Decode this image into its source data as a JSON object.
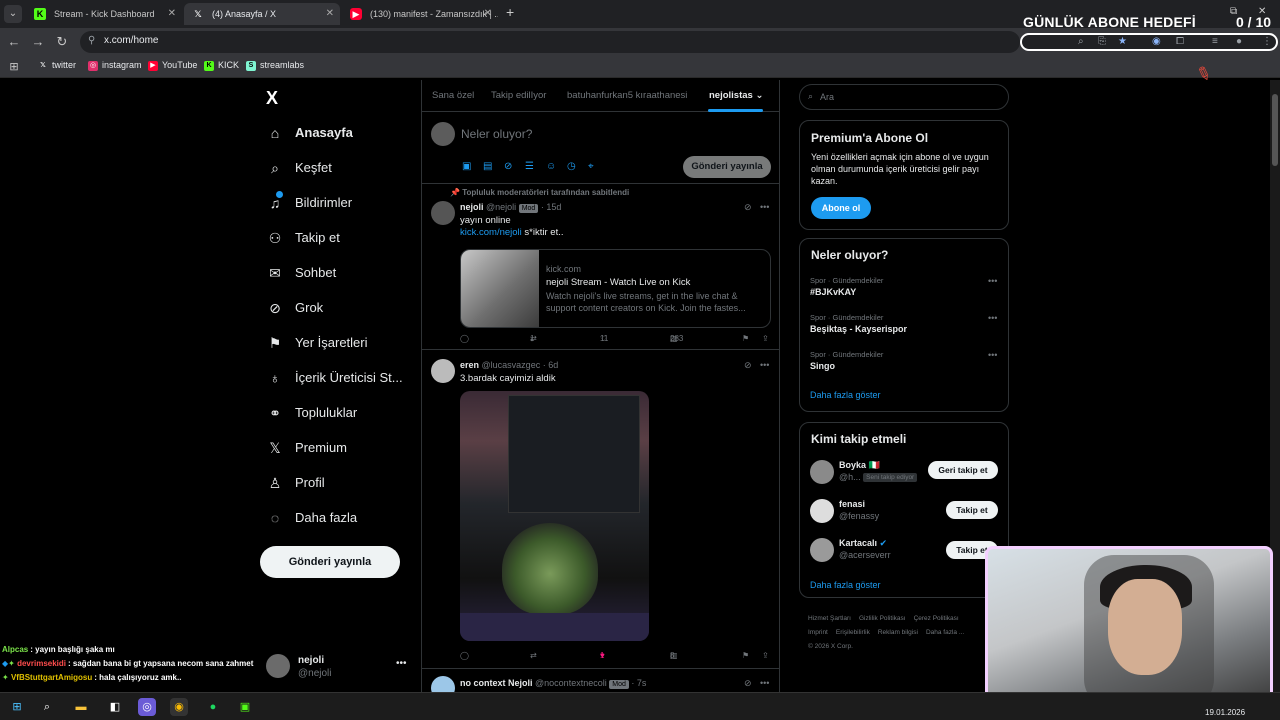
{
  "browser": {
    "tabs": [
      {
        "title": "Stream - Kick Dashboard",
        "icon": "kick-icon",
        "color": "#53fc18"
      },
      {
        "title": "(4) Anasayfa / X",
        "icon": "x-icon",
        "color": "#ffffff"
      },
      {
        "title": "(130) manifest - Zamansızdık | ...",
        "icon": "youtube-icon",
        "color": "#ff0033"
      }
    ],
    "url": "x.com/home",
    "bookmarks": [
      {
        "label": "twitter",
        "icon": "x-icon"
      },
      {
        "label": "instagram",
        "icon": "instagram-icon"
      },
      {
        "label": "YouTube",
        "icon": "youtube-icon"
      },
      {
        "label": "KICK",
        "icon": "kick-icon"
      },
      {
        "label": "streamlabs",
        "icon": "streamlabs-icon"
      }
    ]
  },
  "overlay": {
    "goal_title": "GÜNLÜK ABONE HEDEFİ",
    "goal_count": "0  / 10",
    "chat": [
      {
        "user": "Alpcas",
        "user_color": "#7be34a",
        "msg": ": yayın başlığı şaka mı"
      },
      {
        "user": "devrimsekidi",
        "user_color": "#ff4d4d",
        "msg": ": sağdan bana bi gt yapsana necom sana zahmet"
      },
      {
        "user": "VfBStuttgartAmigosu",
        "user_color": "#e0c000",
        "msg": ": hala çalışıyoruz amk.."
      }
    ],
    "date": "19.01.2026"
  },
  "nav": {
    "logo": "X",
    "items": [
      {
        "label": "Anasayfa",
        "icon": "home-icon",
        "bold": true
      },
      {
        "label": "Keşfet",
        "icon": "search-icon"
      },
      {
        "label": "Bildirimler",
        "icon": "bell-icon"
      },
      {
        "label": "Takip et",
        "icon": "add-person-icon"
      },
      {
        "label": "Sohbet",
        "icon": "mail-icon"
      },
      {
        "label": "Grok",
        "icon": "grok-icon"
      },
      {
        "label": "Yer İşaretleri",
        "icon": "bookmark-icon"
      },
      {
        "label": "İçerik Üreticisi St...",
        "icon": "creator-icon"
      },
      {
        "label": "Topluluklar",
        "icon": "communities-icon"
      },
      {
        "label": "Premium",
        "icon": "x-icon"
      },
      {
        "label": "Profil",
        "icon": "person-icon"
      },
      {
        "label": "Daha fazla",
        "icon": "more-circle-icon"
      }
    ],
    "post_button": "Gönderi yayınla",
    "account": {
      "name": "nejoli",
      "handle": "@nejoli"
    }
  },
  "timeline": {
    "tabs": [
      "Sana özel",
      "Takip edilIyor",
      "batuhanfurkan5 kıraathanesi",
      "nejolistas"
    ],
    "compose_placeholder": "Neler oluyor?",
    "compose_button": "Gönderi yayınla",
    "tweets": [
      {
        "pinned": "Topluluk moderatörleri tarafından sabitlendi",
        "name": "nejoli",
        "handle": "@nejoli",
        "badge": "Mod",
        "time": "· 15d",
        "text1": "yayın online",
        "link": "kick.com/nejoli",
        "text2": " s*iktir et..",
        "card": {
          "domain": "kick.com",
          "title": "nejoli Stream - Watch Live on Kick",
          "desc": "Watch nejoli's live streams, get in the live chat & support content creators on Kick. Join the fastes..."
        },
        "reply": "",
        "retweet": "1",
        "like": "11",
        "views": "283"
      },
      {
        "name": "eren",
        "handle": "@lucasvazgec",
        "time": "· 6d",
        "text1": "3.bardak cayimizi aldik",
        "reply": "",
        "retweet": "",
        "like": "1",
        "views": "8"
      },
      {
        "name": "no context Nejoli",
        "handle": "@nocontextnecoli",
        "badge": "Mod",
        "time": "· 7s"
      }
    ]
  },
  "sidebar": {
    "search_placeholder": "Ara",
    "premium": {
      "title": "Premium'a Abone Ol",
      "desc": "Yeni özellikleri açmak için abone ol ve uygun olman durumunda içerik üreticisi gelir payı kazan.",
      "button": "Abone ol"
    },
    "trends_title": "Neler oluyor?",
    "trends": [
      {
        "cat": "Spor · Gündemdekiler",
        "name": "#BJKvKAY"
      },
      {
        "cat": "Spor · Gündemdekiler",
        "name": "Beşiktaş - Kayserispor"
      },
      {
        "cat": "Spor · Gündemdekiler",
        "name": "Singo"
      }
    ],
    "show_more": "Daha fazla göster",
    "wtf_title": "Kimi takip etmeli",
    "wtf": [
      {
        "name": "Boyka 🇮🇹",
        "handle": "@h...",
        "tag": "Seni takip ediyor",
        "button": "Geri takip et"
      },
      {
        "name": "fenasi",
        "handle": "@fenassy",
        "button": "Takip et"
      },
      {
        "name": "Kartacalı",
        "handle": "@acerseverr",
        "button": "Takip et",
        "verified": true
      }
    ],
    "wtf_more": "Daha fazla göster",
    "footer": [
      "Hizmet Şartları",
      "Gizlilik Politikası",
      "Çerez Politikası",
      "Imprint",
      "Erişilebilirlik",
      "Reklam bilgisi",
      "Daha fazla ...",
      "© 2026 X Corp."
    ]
  },
  "colors": {
    "accent": "#1d9bf0",
    "like": "#f91880",
    "bg": "#000000"
  }
}
